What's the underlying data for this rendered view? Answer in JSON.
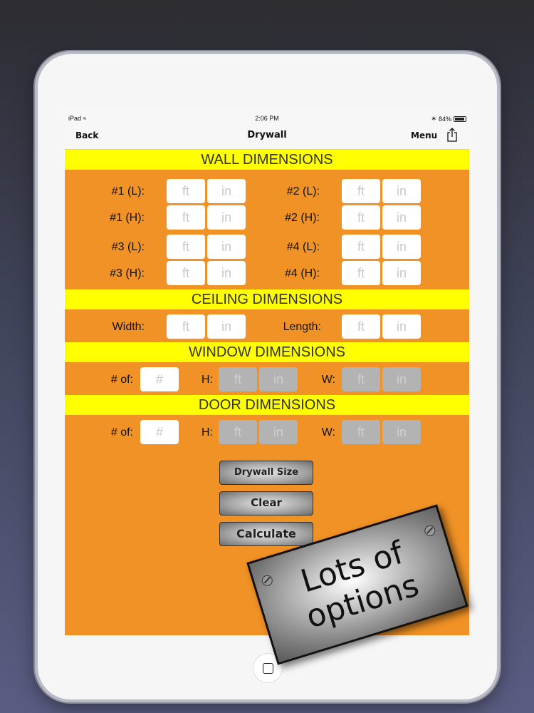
{
  "status": {
    "device": "iPad",
    "time": "2:06 PM",
    "battery": "84%"
  },
  "nav": {
    "back": "Back",
    "title": "Drywall",
    "menu": "Menu"
  },
  "sections": {
    "wall": "WALL DIMENSIONS",
    "ceiling": "CEILING DIMENSIONS",
    "window": "WINDOW DIMENSIONS",
    "door": "DOOR DIMENSIONS"
  },
  "wall_labels": {
    "w1l": "#1 (L):",
    "w1h": "#1 (H):",
    "w2l": "#2 (L):",
    "w2h": "#2 (H):",
    "w3l": "#3 (L):",
    "w3h": "#3 (H):",
    "w4l": "#4 (L):",
    "w4h": "#4 (H):"
  },
  "ceiling_labels": {
    "width": "Width:",
    "length": "Length:"
  },
  "opening_labels": {
    "count": "# of:",
    "h": "H:",
    "w": "W:"
  },
  "placeholders": {
    "ft": "ft",
    "in": "in",
    "count": "#"
  },
  "buttons": {
    "drywall_size": "Drywall Size",
    "clear": "Clear",
    "calculate": "Calculate"
  },
  "sign": {
    "line1": "Lots of",
    "line2": "options"
  },
  "colors": {
    "background": "#f09225",
    "section": "#ffff00"
  }
}
